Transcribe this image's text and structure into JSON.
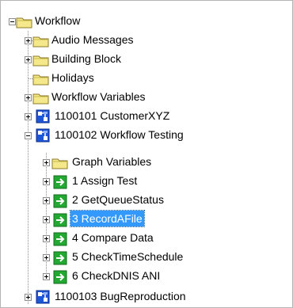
{
  "tree": {
    "root": {
      "label": "Workflow",
      "icon": "folder-icon",
      "state": "expanded"
    },
    "items": [
      {
        "label": "Audio Messages",
        "icon": "folder-icon",
        "state": "collapsed"
      },
      {
        "label": "Building Block",
        "icon": "folder-icon",
        "state": "collapsed"
      },
      {
        "label": "Holidays",
        "icon": "folder-icon",
        "state": "leaf"
      },
      {
        "label": "Workflow Variables",
        "icon": "folder-icon",
        "state": "collapsed"
      },
      {
        "label": "1100101 CustomerXYZ",
        "icon": "workflow-icon",
        "state": "collapsed"
      },
      {
        "label": "1100102 Workflow Testing",
        "icon": "workflow-icon",
        "state": "expanded"
      },
      {
        "label": "Graph Variables",
        "icon": "folder-icon",
        "state": "collapsed"
      },
      {
        "label": "1 Assign Test",
        "icon": "step-arrow-icon",
        "state": "collapsed"
      },
      {
        "label": "2 GetQueueStatus",
        "icon": "step-arrow-icon",
        "state": "collapsed"
      },
      {
        "label": "3 RecordAFile",
        "icon": "step-arrow-icon",
        "state": "collapsed",
        "selected": true
      },
      {
        "label": "4 Compare Data",
        "icon": "step-arrow-icon",
        "state": "collapsed"
      },
      {
        "label": "5 CheckTimeSchedule",
        "icon": "step-arrow-icon",
        "state": "collapsed"
      },
      {
        "label": "6 CheckDNIS ANI",
        "icon": "step-arrow-icon",
        "state": "collapsed"
      },
      {
        "label": "1100103 BugReproduction",
        "icon": "workflow-icon",
        "state": "collapsed"
      }
    ]
  },
  "colors": {
    "selection": "#3399ff",
    "folder": "#f5e88a",
    "workflow_blue": "#1f56d6",
    "step_green": "#23a832"
  }
}
